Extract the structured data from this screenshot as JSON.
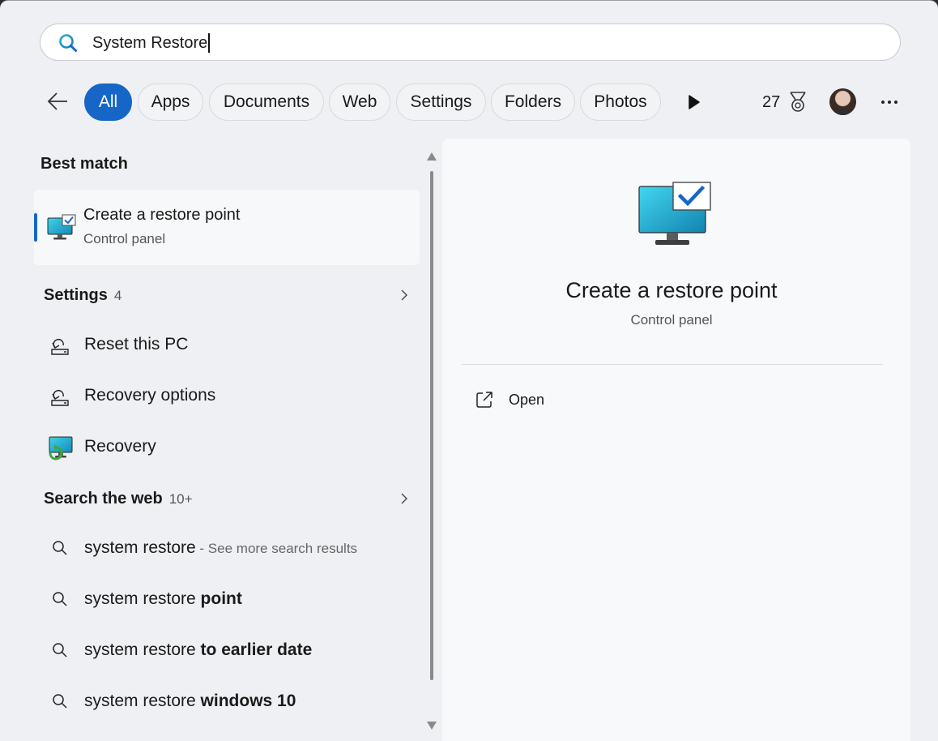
{
  "search": {
    "value": "System Restore"
  },
  "filters": {
    "items": [
      {
        "label": "All",
        "active": true
      },
      {
        "label": "Apps"
      },
      {
        "label": "Documents"
      },
      {
        "label": "Web"
      },
      {
        "label": "Settings"
      },
      {
        "label": "Folders"
      },
      {
        "label": "Photos"
      }
    ],
    "points": "27"
  },
  "best_match": {
    "heading": "Best match",
    "title": "Create a restore point",
    "subtitle": "Control panel",
    "icon": "restore-point-monitor-icon"
  },
  "settings_section": {
    "heading": "Settings",
    "count": "4",
    "items": [
      {
        "label": "Reset this PC",
        "icon": "reset-pc-icon"
      },
      {
        "label": "Recovery options",
        "icon": "reset-pc-icon"
      },
      {
        "label": "Recovery",
        "icon": "recovery-monitor-icon"
      }
    ]
  },
  "web_section": {
    "heading": "Search the web",
    "count": "10+",
    "items": [
      {
        "prefix": "system restore",
        "bold": "",
        "suffix": " - See more search results"
      },
      {
        "prefix": "system restore ",
        "bold": "point",
        "suffix": ""
      },
      {
        "prefix": "system restore ",
        "bold": "to earlier date",
        "suffix": ""
      },
      {
        "prefix": "system restore ",
        "bold": "windows 10",
        "suffix": ""
      }
    ]
  },
  "detail": {
    "title": "Create a restore point",
    "subtitle": "Control panel",
    "action_open": "Open"
  },
  "colors": {
    "accent": "#1566c7",
    "background": "#eef0f3"
  }
}
